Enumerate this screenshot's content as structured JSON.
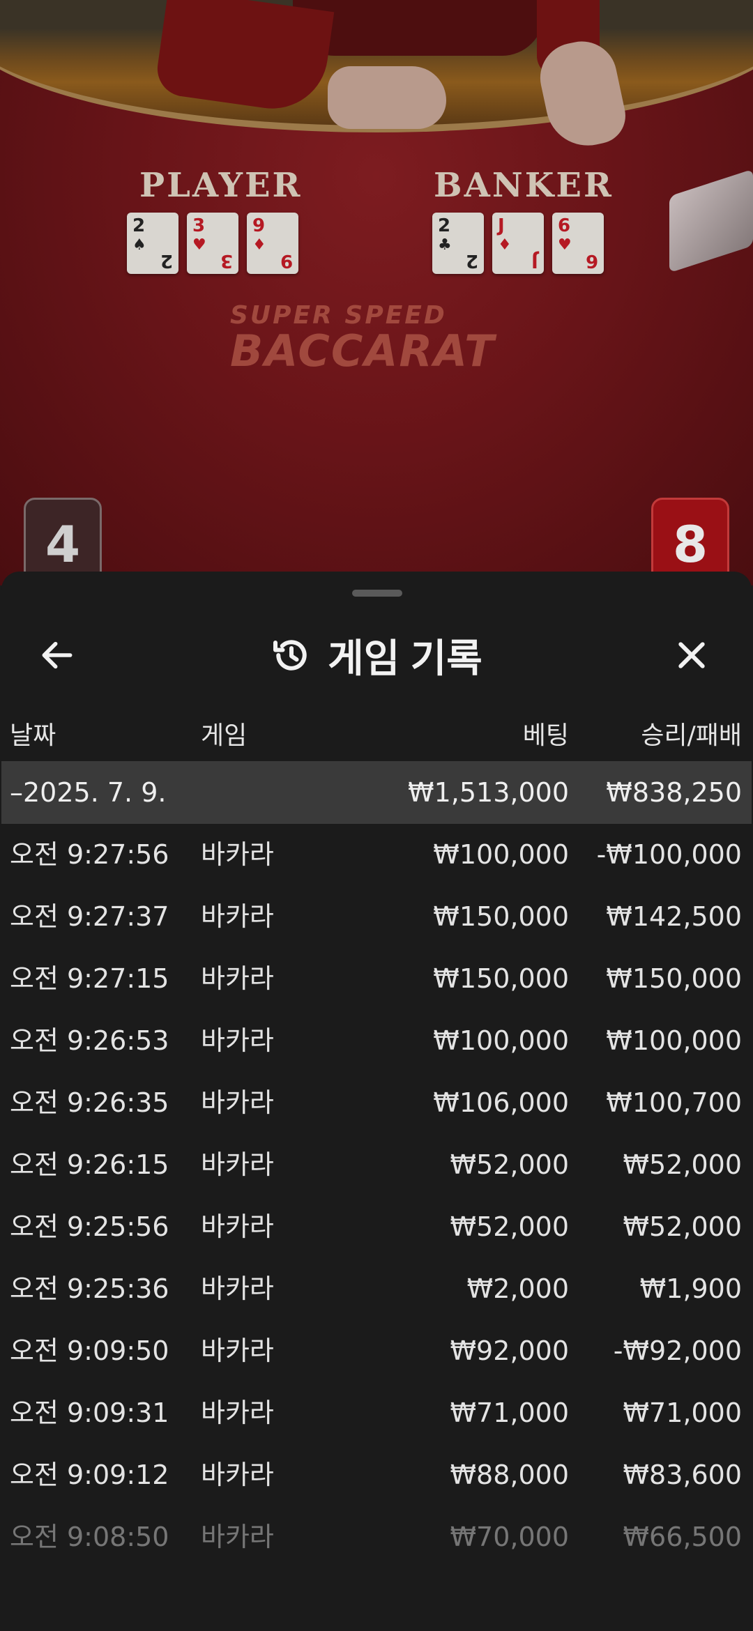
{
  "table": {
    "player_label": "PLAYER",
    "banker_label": "BANKER",
    "player_score": "4",
    "banker_score": "8",
    "logo_line1": "SUPER SPEED",
    "logo_line2": "BACCARAT",
    "player_cards": [
      {
        "rank": "2",
        "suit": "♠",
        "color": "black"
      },
      {
        "rank": "3",
        "suit": "♥",
        "color": "red"
      },
      {
        "rank": "9",
        "suit": "♦",
        "color": "red"
      }
    ],
    "banker_cards": [
      {
        "rank": "2",
        "suit": "♣",
        "color": "black"
      },
      {
        "rank": "J",
        "suit": "♦",
        "color": "red"
      },
      {
        "rank": "6",
        "suit": "♥",
        "color": "red"
      }
    ]
  },
  "sheet": {
    "title": "게임 기록",
    "icons": {
      "back": "arrow-left-icon",
      "history": "history-icon",
      "close": "close-icon"
    },
    "columns": {
      "date": "날짜",
      "game": "게임",
      "bet": "베팅",
      "result": "승리/패배"
    },
    "summary": {
      "date": "–2025. 7. 9.",
      "bet": "₩1,513,000",
      "result": "₩838,250"
    },
    "rows": [
      {
        "time": "오전 9:27:56",
        "game": "바카라",
        "bet": "₩100,000",
        "result": "-₩100,000"
      },
      {
        "time": "오전 9:27:37",
        "game": "바카라",
        "bet": "₩150,000",
        "result": "₩142,500"
      },
      {
        "time": "오전 9:27:15",
        "game": "바카라",
        "bet": "₩150,000",
        "result": "₩150,000"
      },
      {
        "time": "오전 9:26:53",
        "game": "바카라",
        "bet": "₩100,000",
        "result": "₩100,000"
      },
      {
        "time": "오전 9:26:35",
        "game": "바카라",
        "bet": "₩106,000",
        "result": "₩100,700"
      },
      {
        "time": "오전 9:26:15",
        "game": "바카라",
        "bet": "₩52,000",
        "result": "₩52,000"
      },
      {
        "time": "오전 9:25:56",
        "game": "바카라",
        "bet": "₩52,000",
        "result": "₩52,000"
      },
      {
        "time": "오전 9:25:36",
        "game": "바카라",
        "bet": "₩2,000",
        "result": "₩1,900"
      },
      {
        "time": "오전 9:09:50",
        "game": "바카라",
        "bet": "₩92,000",
        "result": "-₩92,000"
      },
      {
        "time": "오전 9:09:31",
        "game": "바카라",
        "bet": "₩71,000",
        "result": "₩71,000"
      },
      {
        "time": "오전 9:09:12",
        "game": "바카라",
        "bet": "₩88,000",
        "result": "₩83,600"
      },
      {
        "time": "오전 9:08:50",
        "game": "바카라",
        "bet": "₩70,000",
        "result": "₩66,500"
      }
    ]
  },
  "colors": {
    "sheet_bg": "#1b1b1b",
    "summary_bg": "#3a3a3a",
    "banker_red": "#9a1015",
    "table_red": "#6b1519"
  }
}
